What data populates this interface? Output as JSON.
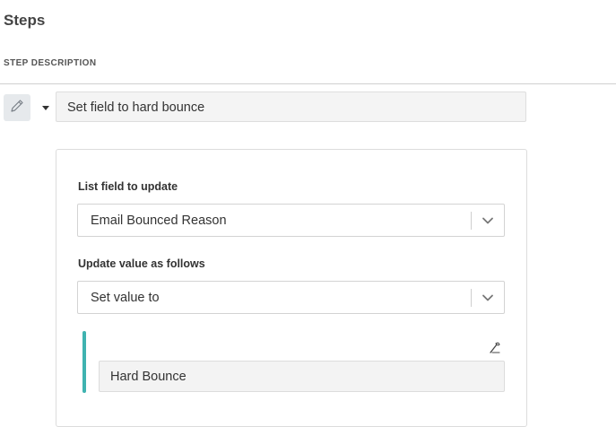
{
  "header": {
    "title": "Steps"
  },
  "section": {
    "label": "STEP DESCRIPTION"
  },
  "step": {
    "description": "Set field to hard bounce"
  },
  "form": {
    "field_label": "List field to update",
    "field_value": "Email Bounced Reason",
    "update_label": "Update value as follows",
    "update_value": "Set value to",
    "value_input": "Hard Bounce"
  },
  "icons": {
    "edit": "pencil-icon",
    "collapse": "caret-down-icon",
    "dropdown": "chevron-down-icon",
    "personalize": "wand-icon"
  },
  "colors": {
    "accent": "#3fb3b0",
    "icon_button_bg": "#e6e9ec"
  }
}
